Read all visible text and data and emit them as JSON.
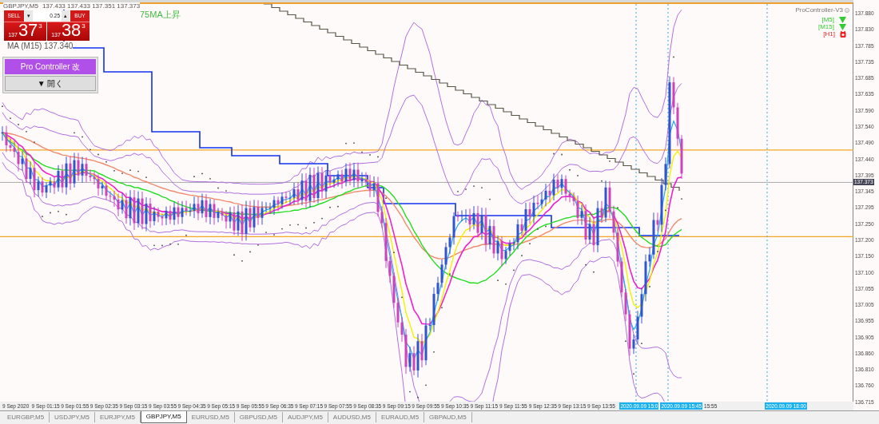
{
  "chart": {
    "symbol": "GBPJPY,M5",
    "ohlc": "137.433 137.433 137.351 137.373",
    "trade_panel": {
      "sell_label": "SELL",
      "buy_label": "BUY",
      "lot": "0.25",
      "spin_down": "▾",
      "spin_up": "▴",
      "sell_price": {
        "prefix": "137",
        "main": "37",
        "suffix": "3"
      },
      "buy_price": {
        "prefix": "137",
        "main": "38",
        "suffix": "3"
      }
    },
    "ma_label": "MA (M15) 137.340",
    "trend_note": "75MA上昇",
    "pro_controller": {
      "title": "Pro Controller 改",
      "toggle": "▼ 開く"
    },
    "indicator_name": "ProController-V3",
    "timeframes": [
      {
        "label": "[M5]",
        "kind": "down",
        "color": "#33cc33"
      },
      {
        "label": "[M15]",
        "kind": "down",
        "color": "#33cc33"
      },
      {
        "label": "[H1]",
        "kind": "hold",
        "color": "#ee2222"
      }
    ]
  },
  "price_axis": {
    "labels": [
      "137.880",
      "137.830",
      "137.785",
      "137.735",
      "137.685",
      "137.635",
      "137.590",
      "137.540",
      "137.490",
      "137.440",
      "137.395",
      "137.345",
      "137.295",
      "137.250",
      "137.200",
      "137.150",
      "137.100",
      "137.055",
      "137.005",
      "136.955",
      "136.905",
      "136.860",
      "136.810",
      "136.760",
      "136.715"
    ],
    "current": "137.373"
  },
  "time_axis": {
    "labels": [
      "9 Sep 2020",
      "9 Sep 01:15",
      "9 Sep 01:55",
      "9 Sep 02:35",
      "9 Sep 03:15",
      "9 Sep 03:55",
      "9 Sep 04:35",
      "9 Sep 05:15",
      "9 Sep 05:55",
      "9 Sep 06:35",
      "9 Sep 07:15",
      "9 Sep 07:55",
      "9 Sep 08:35",
      "9 Sep 09:15",
      "9 Sep 09:55",
      "9 Sep 10:35",
      "9 Sep 11:15",
      "9 Sep 11:55",
      "9 Sep 12:35",
      "9 Sep 13:15",
      "9 Sep 13:55"
    ],
    "markers": [
      "2020.09.09 15:0",
      "2020.09.09 15:45"
    ],
    "tail": "15:55",
    "far_marker": "2020.09.09 18:00"
  },
  "tabs": [
    {
      "label": "EURGBP,M5",
      "selected": false
    },
    {
      "label": "USDJPY,M5",
      "selected": false
    },
    {
      "label": "EURJPY,M5",
      "selected": false
    },
    {
      "label": "GBPJPY,M5",
      "selected": true
    },
    {
      "label": "EURUSD,M5",
      "selected": false
    },
    {
      "label": "GBPUSD,M5",
      "selected": false
    },
    {
      "label": "AUDJPY,M5",
      "selected": false
    },
    {
      "label": "AUDUSD,M5",
      "selected": false
    },
    {
      "label": "EURAUD,M5",
      "selected": false
    },
    {
      "label": "GBPAUD,M5",
      "selected": false
    }
  ]
}
